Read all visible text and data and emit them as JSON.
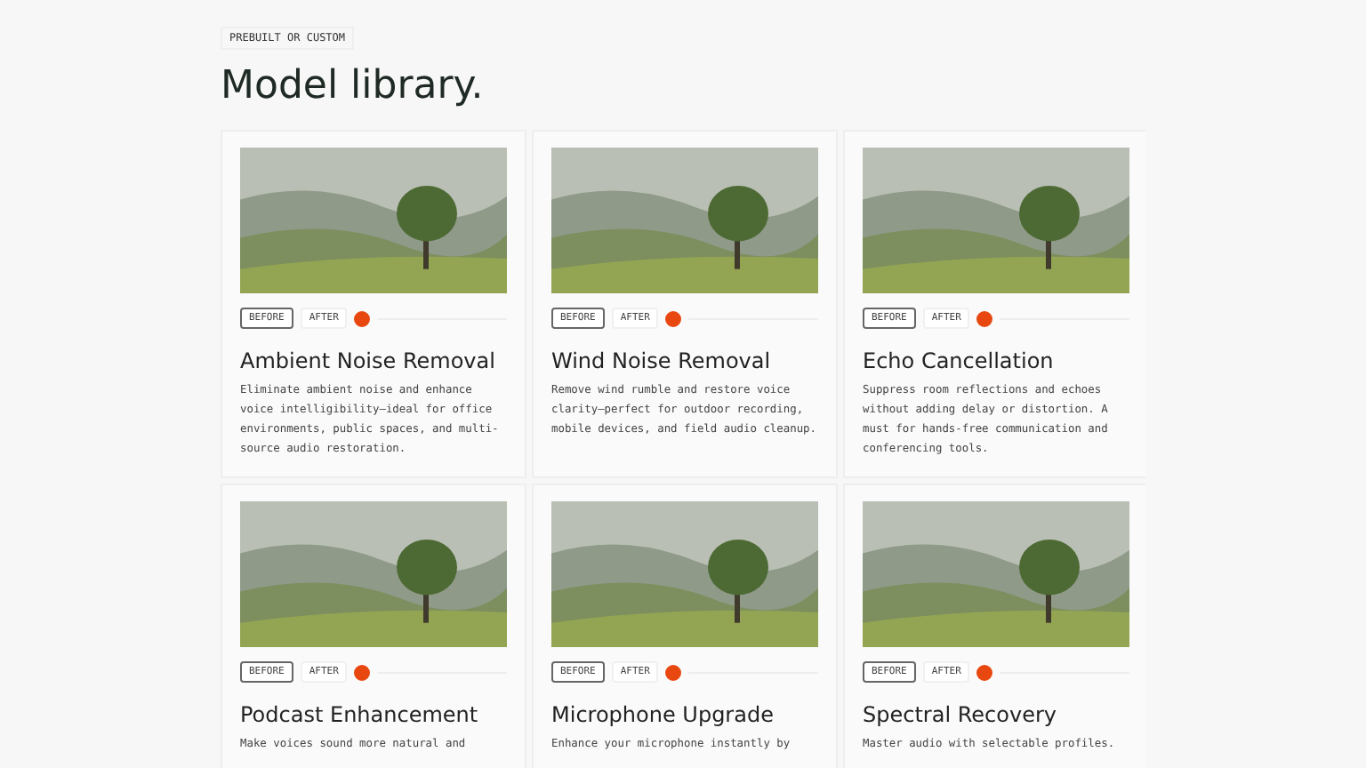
{
  "eyebrow": "PREBUILT OR CUSTOM",
  "title": "Model library.",
  "cards": [
    {
      "toggle": [
        {
          "label": "BEFORE",
          "selected": true
        },
        {
          "label": "AFTER",
          "selected": false
        }
      ],
      "name": "Ambient Noise Removal",
      "description": "Eliminate ambient noise and enhance voice intelligibility—ideal for office environments, public spaces, and multi-source audio restoration."
    },
    {
      "toggle": [
        {
          "label": "BEFORE",
          "selected": true
        },
        {
          "label": "AFTER",
          "selected": false
        }
      ],
      "name": "Wind Noise Removal",
      "description": "Remove wind rumble and restore voice clarity—perfect for outdoor recording, mobile devices, and field audio cleanup."
    },
    {
      "toggle": [
        {
          "label": "BEFORE",
          "selected": true
        },
        {
          "label": "AFTER",
          "selected": false
        }
      ],
      "name": "Echo Cancellation",
      "description": "Suppress room reflections and echoes without adding delay or distortion. A must for hands-free communication and conferencing tools."
    },
    {
      "toggle": [
        {
          "label": "BEFORE",
          "selected": true
        },
        {
          "label": "AFTER",
          "selected": false
        }
      ],
      "name": "Podcast Enhancement",
      "description": "Make voices sound more natural and"
    },
    {
      "toggle": [
        {
          "label": "BEFORE",
          "selected": true
        },
        {
          "label": "AFTER",
          "selected": false
        }
      ],
      "name": "Microphone Upgrade",
      "description": "Enhance your microphone instantly by"
    },
    {
      "toggle": [
        {
          "label": "BEFORE",
          "selected": true
        },
        {
          "label": "AFTER",
          "selected": false
        }
      ],
      "name": "Spectral Recovery",
      "description": "Master audio with selectable profiles."
    }
  ]
}
